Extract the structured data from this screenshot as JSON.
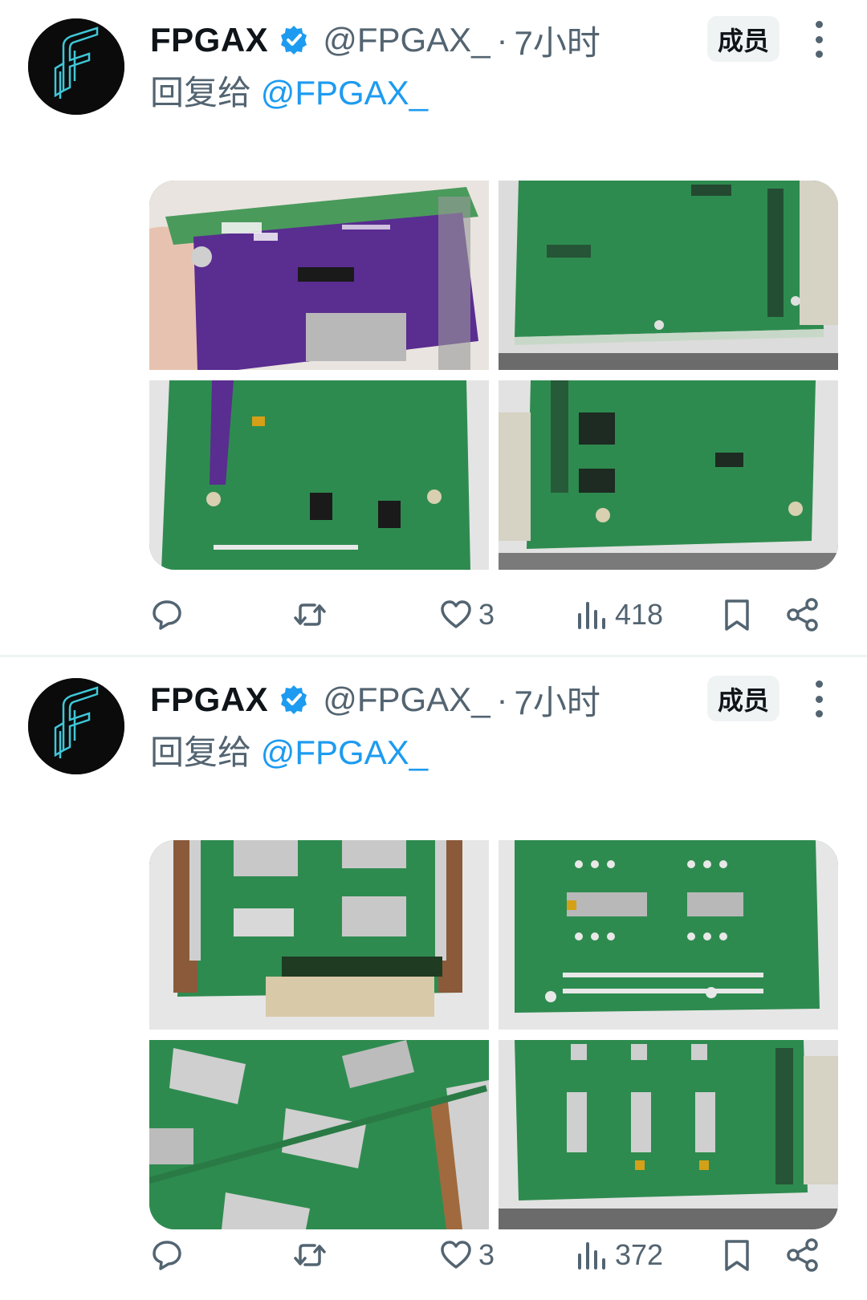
{
  "tweets": [
    {
      "author_name": "FPGAX",
      "handle": "@FPGAX_",
      "separator": "·",
      "time": "7小时",
      "badge": "成员",
      "reply_prefix": "回复给",
      "reply_mention": "@FPGAX_",
      "photos": [
        "pcb-photo-purple-board",
        "pcb-photo-green-board",
        "pcb-photo-green-board",
        "pcb-photo-green-board"
      ],
      "likes": "3",
      "views": "418"
    },
    {
      "author_name": "FPGAX",
      "handle": "@FPGAX_",
      "separator": "·",
      "time": "7小时",
      "badge": "成员",
      "reply_prefix": "回复给",
      "reply_mention": "@FPGAX_",
      "photos": [
        "pcb-photo-green-board",
        "pcb-photo-green-board",
        "pcb-photo-green-board",
        "pcb-photo-green-board"
      ],
      "likes": "3",
      "views": "372"
    }
  ],
  "colors": {
    "link": "#1d9bf0",
    "secondary_text": "#536471",
    "pcb_green": "#2e8b4f",
    "pcb_purple": "#5a2d91",
    "avatar_bg": "#0b0b0b",
    "avatar_logo": "#3fc7d8"
  },
  "icons": [
    "verified-badge-icon",
    "more-options-icon",
    "reply-icon",
    "retweet-icon",
    "like-icon",
    "views-icon",
    "bookmark-icon",
    "share-icon"
  ]
}
